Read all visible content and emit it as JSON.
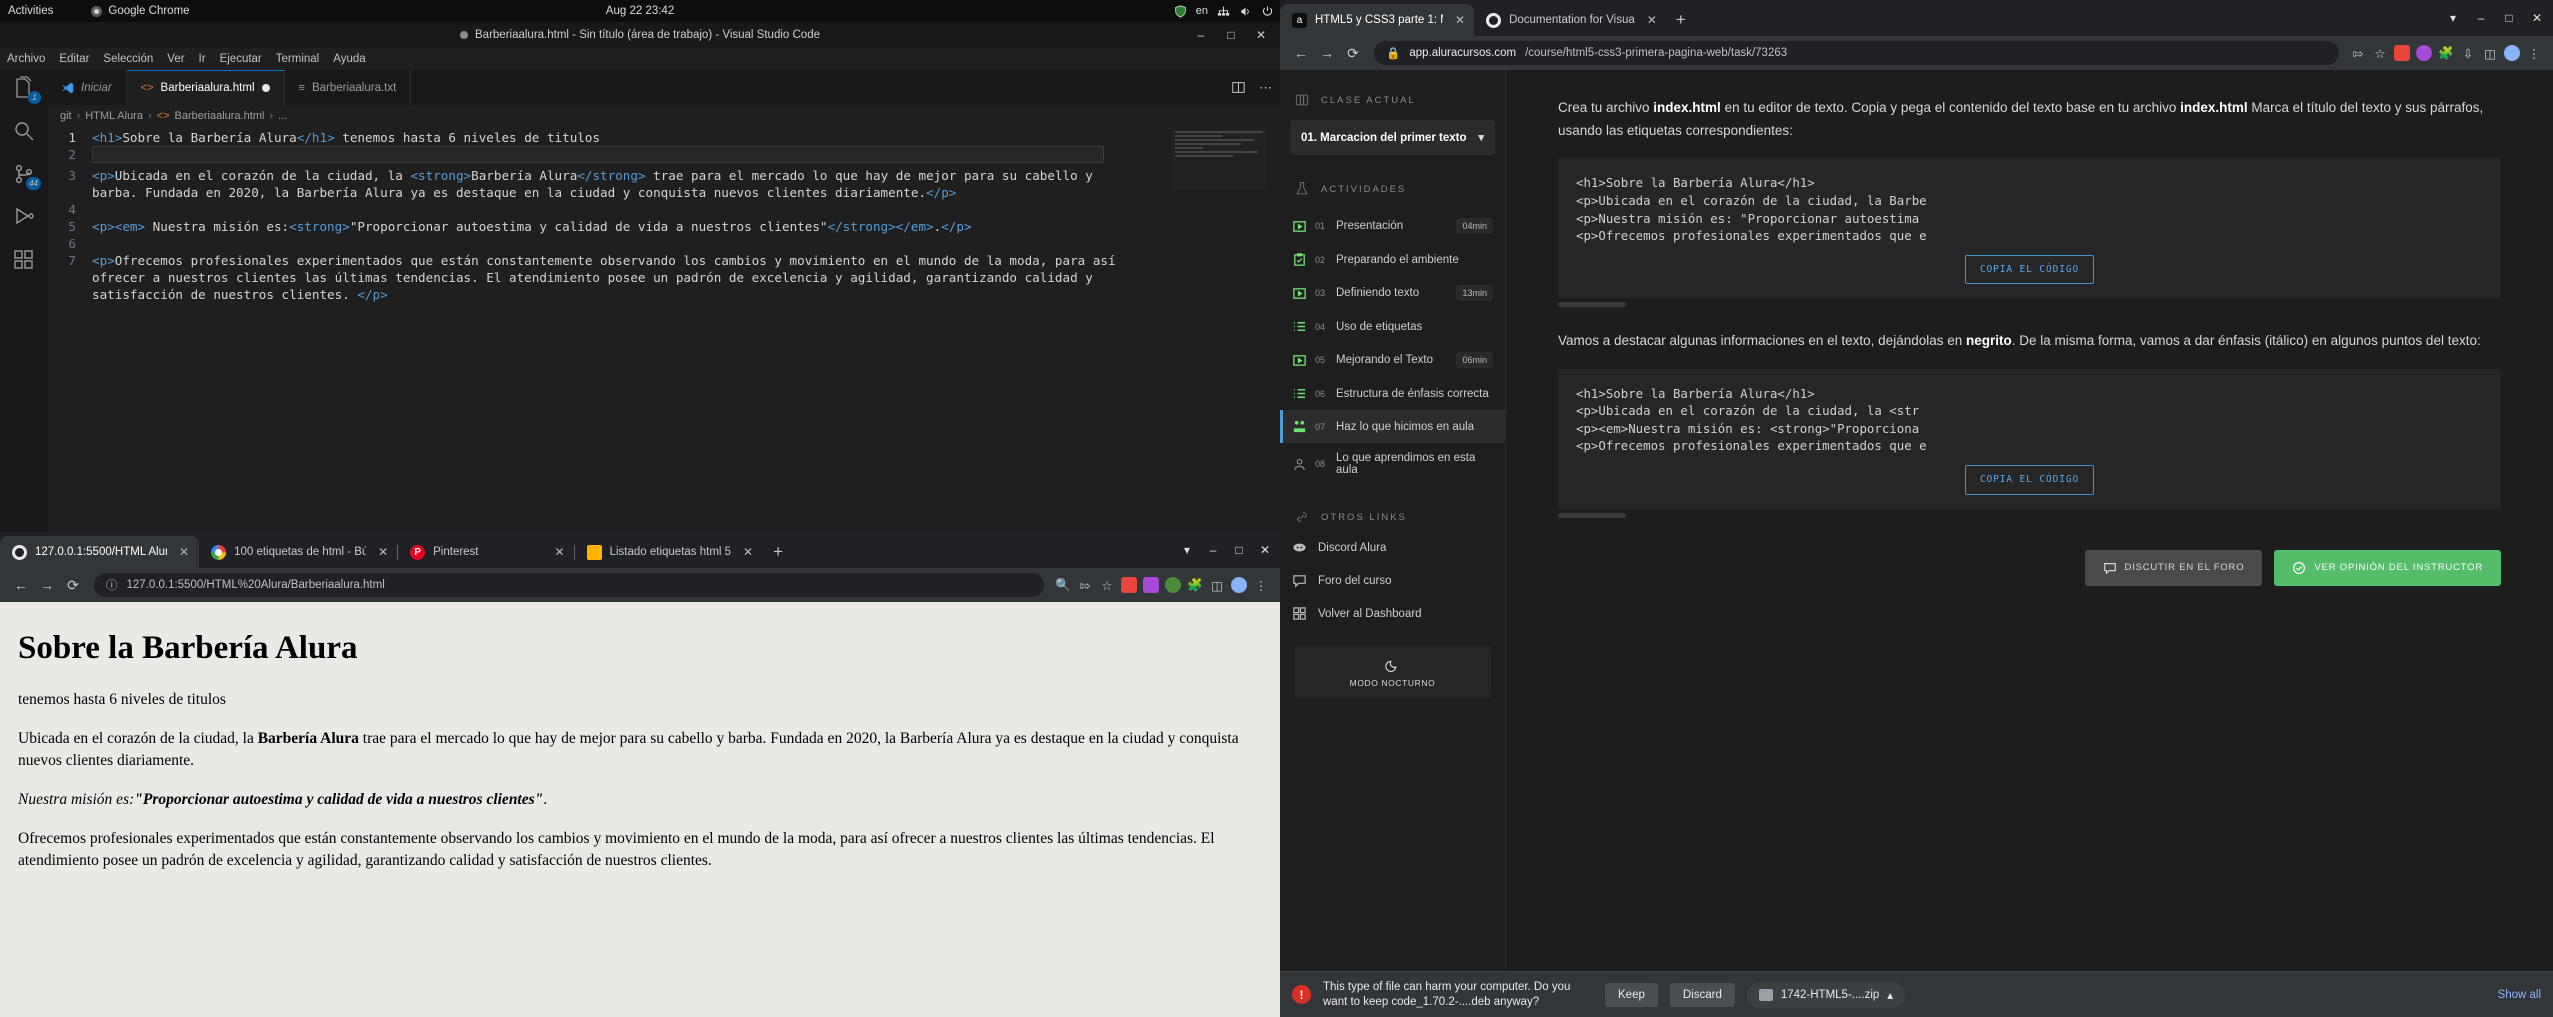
{
  "gnome": {
    "activities": "Activities",
    "app_name": "Google Chrome",
    "clock": "Aug 22  23:42",
    "keyboard": "en"
  },
  "vscode": {
    "window_title": "Barberiaalura.html - Sin título (área de trabajo) - Visual Studio Code",
    "menu": [
      "Archivo",
      "Editar",
      "Selección",
      "Ver",
      "Ir",
      "Ejecutar",
      "Terminal",
      "Ayuda"
    ],
    "tabs": [
      {
        "label": "Iniciar",
        "icon": "vscode-logo-icon",
        "active": false,
        "dirty": false
      },
      {
        "label": "Barberiaalura.html",
        "icon": "html-file-icon",
        "active": true,
        "dirty": true
      },
      {
        "label": "Barberiaalura.txt",
        "icon": "text-file-icon",
        "active": false,
        "dirty": false
      }
    ],
    "breadcrumb": [
      "git",
      "HTML Alura",
      "Barberiaalura.html",
      "..."
    ],
    "activity_badges": {
      "explorer": "1",
      "source_control": "44"
    },
    "code_lines": [
      {
        "n": "1",
        "text": "<h1>Sobre la Barbería Alura</h1> tenemos hasta 6 niveles de titulos"
      },
      {
        "n": "2",
        "text": ""
      },
      {
        "n": "3",
        "text": "<p>Ubicada en el corazón de la ciudad, la <strong>Barbería Alura</strong> trae para el mercado lo que hay de mejor para su cabello y barba. Fundada en 2020, la Barbería Alura ya es destaque en la ciudad y conquista nuevos clientes diariamente.</p>"
      },
      {
        "n": "4",
        "text": ""
      },
      {
        "n": "5",
        "text": "<p><em> Nuestra misión es:<strong>\"Proporcionar autoestima y calidad de vida a nuestros clientes\"</strong></em>.</p>"
      },
      {
        "n": "6",
        "text": ""
      },
      {
        "n": "7",
        "text": "<p>Ofrecemos profesionales experimentados que están constantemente observando los cambios y movimiento en el mundo de la moda, para así ofrecer a nuestros clientes las últimas tendencias. El atendimiento posee un padrón de excelencia y agilidad, garantizando calidad y satisfacción de nuestros clientes. </p>"
      }
    ]
  },
  "chrome_local": {
    "tabs": [
      {
        "label": "127.0.0.1:5500/HTML Alur",
        "favicon": "live-server-icon",
        "active": true
      },
      {
        "label": "100 etiquetas de html - Bú",
        "favicon": "google-icon",
        "active": false
      },
      {
        "label": "Pinterest",
        "favicon": "pinterest-icon",
        "active": false
      },
      {
        "label": "Listado etiquetas html 5",
        "favicon": "document-icon",
        "active": false
      }
    ],
    "url": "127.0.0.1:5500/HTML%20Alura/Barberiaalura.html",
    "url_host": "127.0.0.1",
    "url_path": ":5500/HTML%20Alura/Barberiaalura.html",
    "page": {
      "h1": "Sobre la Barbería Alura",
      "p1": "tenemos hasta 6 niveles de titulos",
      "p2_a": "Ubicada en el corazón de la ciudad, la ",
      "p2_strong": "Barbería Alura",
      "p2_b": " trae para el mercado lo que hay de mejor para su cabello y barba. Fundada en 2020, la Barbería Alura ya es destaque en la ciudad y conquista nuevos clientes diariamente.",
      "p3_em": "Nuestra misión es:",
      "p3_strong": "\"Proporcionar autoestima y calidad de vida a nuestros clientes\"",
      "p3_end": ".",
      "p4": "Ofrecemos profesionales experimentados que están constantemente observando los cambios y movimiento en el mundo de la moda, para así ofrecer a nuestros clientes las últimas tendencias. El atendimiento posee un padrón de excelencia y agilidad, garantizando calidad y satisfacción de nuestros clientes."
    }
  },
  "chrome_alura": {
    "tabs": [
      {
        "label": "HTML5 y CSS3 parte 1: Mi",
        "favicon": "alura-icon",
        "active": true
      },
      {
        "label": "Documentation for Visua",
        "favicon": "live-server-icon",
        "active": false
      }
    ],
    "url_host": "app.aluracursos.com",
    "url_path": "/course/html5-css3-primera-pagina-web/task/73263",
    "sidebar": {
      "current_class_header": "CLASE ACTUAL",
      "current_class": "01. Marcacion del primer texto",
      "activities_header": "ACTIVIDADES",
      "activities": [
        {
          "num": "01",
          "name": "Presentación",
          "time": "04min",
          "icon": "video-icon",
          "active": false
        },
        {
          "num": "02",
          "name": "Preparando el ambiente",
          "time": "",
          "icon": "clipboard-check-icon",
          "active": false
        },
        {
          "num": "03",
          "name": "Definiendo texto",
          "time": "13min",
          "icon": "video-icon",
          "active": false
        },
        {
          "num": "04",
          "name": "Uso de etiquetas",
          "time": "",
          "icon": "list-icon",
          "active": false
        },
        {
          "num": "05",
          "name": "Mejorando el Texto",
          "time": "06min",
          "icon": "video-icon",
          "active": false
        },
        {
          "num": "06",
          "name": "Estructura de énfasis correcta",
          "time": "",
          "icon": "list-icon",
          "active": false
        },
        {
          "num": "07",
          "name": "Haz lo que hicimos en aula",
          "time": "",
          "icon": "people-icon",
          "active": true
        },
        {
          "num": "08",
          "name": "Lo que aprendimos en esta aula",
          "time": "",
          "icon": "person-icon",
          "active": false
        }
      ],
      "links_header": "OTROS LINKS",
      "links": [
        {
          "name": "Discord Alura",
          "icon": "discord-icon"
        },
        {
          "name": "Foro del curso",
          "icon": "forum-icon"
        },
        {
          "name": "Volver al Dashboard",
          "icon": "dashboard-icon"
        }
      ],
      "night_mode_label": "MODO NOCTURNO",
      "night_mode_icon": "moon-icon"
    },
    "main": {
      "intro_1": "Crea tu archivo ",
      "intro_1_b": "index.html",
      "intro_2": " en tu editor de texto. Copia y pega el contenido del texto base en tu archivo ",
      "intro_2_b": "index.html",
      "intro_3": " Marca el título del texto y sus párrafos, usando las etiquetas correspondientes:",
      "code1": [
        "<h1>Sobre la Barbería Alura</h1>",
        "<p>Ubicada en el corazón de la ciudad, la Barbe",
        "<p>Nuestra misión es: \"Proporcionar autoestima",
        "<p>Ofrecemos profesionales experimentados que e"
      ],
      "copy_label": "COPIA EL CÓDIGO",
      "mid_1": "Vamos a destacar algunas informaciones en el texto, dejándolas en ",
      "mid_1_b": "negrito",
      "mid_2": ". De la misma forma, vamos a dar énfasis (itálico) en algunos puntos del texto:",
      "code2": [
        "<h1>Sobre la Barbería Alura</h1>",
        "<p>Ubicada en el corazón de la ciudad, la <str",
        "<p><em>Nuestra misión es: <strong>\"Proporciona",
        "<p>Ofrecemos profesionales experimentados que e"
      ],
      "forum_button": "DISCUTIR EN EL FORO",
      "instructor_button": "VER OPINIÓN DEL INSTRUCTOR"
    },
    "download_bar": {
      "message": "This type of file can harm your computer. Do you want to keep code_1.70.2-....deb anyway?",
      "keep": "Keep",
      "discard": "Discard",
      "file_name": "1742-HTML5-....zip",
      "show_all": "Show all"
    }
  },
  "colors": {
    "accent_blue": "#0078d4",
    "alura_green": "#54bd6a",
    "warn_red": "#d93025",
    "link_blue": "#8ab4f8"
  }
}
